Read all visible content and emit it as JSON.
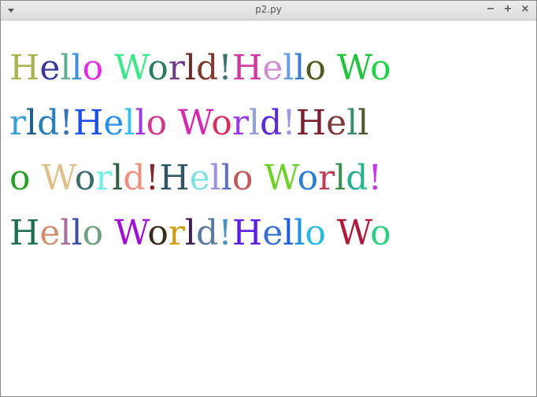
{
  "window": {
    "title": "p2.py",
    "controls": {
      "minimize": "−",
      "maximize": "+",
      "close": "×"
    }
  },
  "lines": [
    [
      {
        "t": "H",
        "c": "#a9b554"
      },
      {
        "t": "e",
        "c": "#3b3a9a"
      },
      {
        "t": "l",
        "c": "#5fb08f"
      },
      {
        "t": "l",
        "c": "#3c8fd8"
      },
      {
        "t": "o",
        "c": "#e12ee6"
      },
      {
        "t": " ",
        "c": "#000000"
      },
      {
        "t": "W",
        "c": "#3ee88a"
      },
      {
        "t": "o",
        "c": "#2a7b60"
      },
      {
        "t": "r",
        "c": "#6f3a8a"
      },
      {
        "t": "l",
        "c": "#6a2b2b"
      },
      {
        "t": "d",
        "c": "#7e3a2e"
      },
      {
        "t": "!",
        "c": "#3e7272"
      },
      {
        "t": "H",
        "c": "#cf3aa2"
      },
      {
        "t": "e",
        "c": "#cf8fcf"
      },
      {
        "t": "l",
        "c": "#6b9de6"
      },
      {
        "t": "l",
        "c": "#3a7fcf"
      },
      {
        "t": "o",
        "c": "#4e5a1e"
      },
      {
        "t": " ",
        "c": "#000000"
      },
      {
        "t": "W",
        "c": "#23c23e"
      },
      {
        "t": "o",
        "c": "#1fd24a"
      }
    ],
    [
      {
        "t": "r",
        "c": "#3a9fd8"
      },
      {
        "t": "l",
        "c": "#1f5f8f"
      },
      {
        "t": "d",
        "c": "#2a7fb8"
      },
      {
        "t": "!",
        "c": "#3a6fb0"
      },
      {
        "t": "H",
        "c": "#1f4fe6"
      },
      {
        "t": "e",
        "c": "#2a8fe6"
      },
      {
        "t": "l",
        "c": "#3abfe6"
      },
      {
        "t": "l",
        "c": "#9f3ad8"
      },
      {
        "t": "o",
        "c": "#cf3a8f"
      },
      {
        "t": " ",
        "c": "#000000"
      },
      {
        "t": "W",
        "c": "#d42ab0"
      },
      {
        "t": "o",
        "c": "#d6305f"
      },
      {
        "t": "r",
        "c": "#9a3ae6"
      },
      {
        "t": "l",
        "c": "#8f9fd8"
      },
      {
        "t": "d",
        "c": "#5a2ad8"
      },
      {
        "t": "!",
        "c": "#a09ae0"
      },
      {
        "t": "H",
        "c": "#7a2030"
      },
      {
        "t": "e",
        "c": "#7e3a3a"
      },
      {
        "t": "l",
        "c": "#3a8f6b"
      },
      {
        "t": "l",
        "c": "#4e5a2e"
      }
    ],
    [
      {
        "t": "o",
        "c": "#2aa02a"
      },
      {
        "t": " ",
        "c": "#000000"
      },
      {
        "t": "W",
        "c": "#dfbf8a"
      },
      {
        "t": "o",
        "c": "#3b6b6b"
      },
      {
        "t": "r",
        "c": "#6fefe0"
      },
      {
        "t": "l",
        "c": "#2f5f3f"
      },
      {
        "t": "d",
        "c": "#f08f80"
      },
      {
        "t": "!",
        "c": "#7e2a2a"
      },
      {
        "t": "H",
        "c": "#2e5560"
      },
      {
        "t": "e",
        "c": "#7fe0e0"
      },
      {
        "t": "l",
        "c": "#a090e0"
      },
      {
        "t": "l",
        "c": "#6070c0"
      },
      {
        "t": "o",
        "c": "#c05a5a"
      },
      {
        "t": " ",
        "c": "#000000"
      },
      {
        "t": "W",
        "c": "#6fd02a"
      },
      {
        "t": "o",
        "c": "#2a7fcf"
      },
      {
        "t": "r",
        "c": "#c03a5a"
      },
      {
        "t": "l",
        "c": "#3a8f4a"
      },
      {
        "t": "d",
        "c": "#2ab08f"
      },
      {
        "t": "!",
        "c": "#c03ae6"
      }
    ],
    [
      {
        "t": "H",
        "c": "#1f6f4f"
      },
      {
        "t": "e",
        "c": "#d09070"
      },
      {
        "t": "l",
        "c": "#a070a0"
      },
      {
        "t": "l",
        "c": "#3a4fa0"
      },
      {
        "t": "o",
        "c": "#6fa07f"
      },
      {
        "t": " ",
        "c": "#000000"
      },
      {
        "t": "W",
        "c": "#a010d0"
      },
      {
        "t": "o",
        "c": "#3a2a1f"
      },
      {
        "t": "r",
        "c": "#d09a10"
      },
      {
        "t": "l",
        "c": "#3a1f4f"
      },
      {
        "t": "d",
        "c": "#5a7aa0"
      },
      {
        "t": "!",
        "c": "#4a90c0"
      },
      {
        "t": "H",
        "c": "#5a1fe0"
      },
      {
        "t": "e",
        "c": "#3a6fd0"
      },
      {
        "t": "l",
        "c": "#1f5fd8"
      },
      {
        "t": "l",
        "c": "#1f8fe0"
      },
      {
        "t": "o",
        "c": "#2ab8e0"
      },
      {
        "t": " ",
        "c": "#000000"
      },
      {
        "t": "W",
        "c": "#b01a3a"
      },
      {
        "t": "o",
        "c": "#2ad07f"
      }
    ]
  ]
}
